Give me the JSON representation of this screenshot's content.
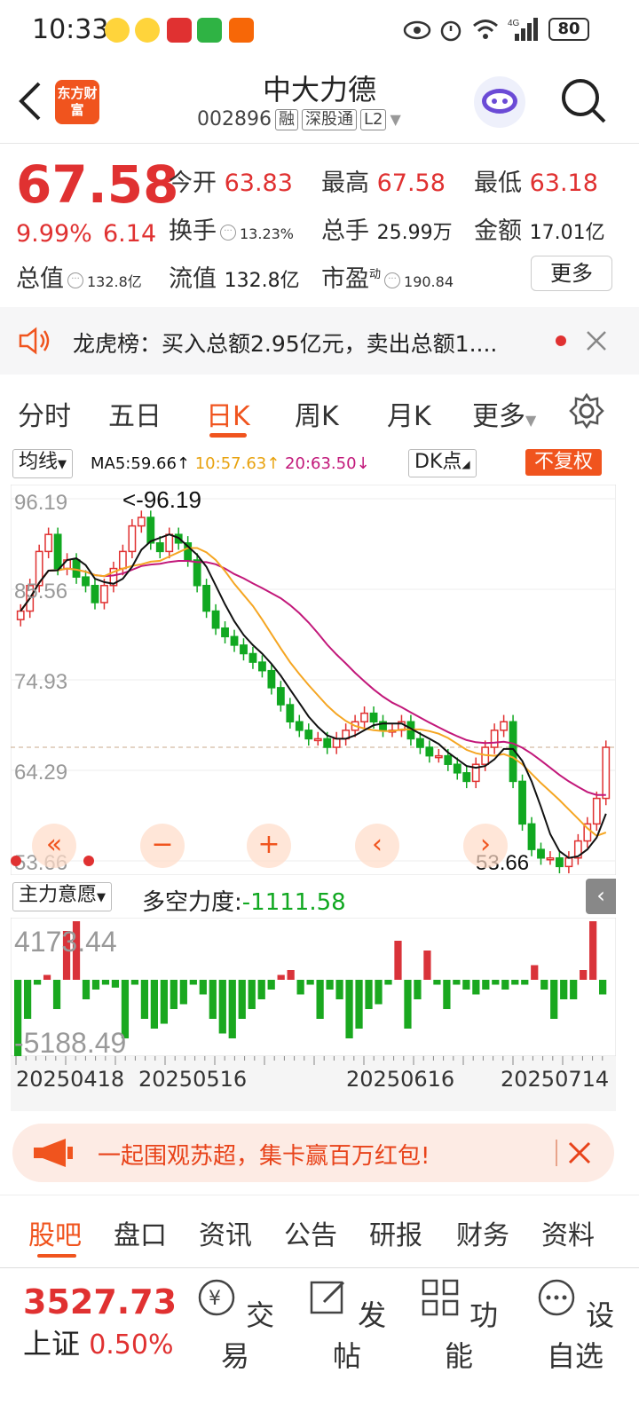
{
  "status": {
    "time": "10:33",
    "battery": "80"
  },
  "header": {
    "logo_text": "东方财富",
    "name": "中大力德",
    "code": "002896",
    "tags": [
      "融",
      "深股通",
      "L2"
    ]
  },
  "quote": {
    "price": "67.58",
    "change_pct": "9.99%",
    "change": "6.14",
    "fields": {
      "open_label": "今开",
      "open": "63.83",
      "high_label": "最高",
      "high": "67.58",
      "low_label": "最低",
      "low": "63.18",
      "turnover_label": "换手",
      "turnover": "13.23%",
      "volume_label": "总手",
      "volume": "25.99万",
      "amount_label": "金额",
      "amount": "17.01亿",
      "mktcap_label": "总值",
      "mktcap": "132.8亿",
      "float_label": "流值",
      "float": "132.8亿",
      "pe_label": "市盈",
      "pe_sup": "动",
      "pe": "190.84"
    },
    "more_label": "更多"
  },
  "notice": {
    "text": "龙虎榜：买入总额2.95亿元，卖出总额1...."
  },
  "tabs": [
    "分时",
    "五日",
    "日K",
    "周K",
    "月K",
    "更多"
  ],
  "active_tab": "日K",
  "chart_toolbar": {
    "ma_select": "均线",
    "ma5": "MA5:59.66↑",
    "ma10": "10:57.63↑",
    "ma20": "20:63.50↓",
    "dk": "DK点",
    "adjust": "不复权"
  },
  "chart_data": [
    {
      "type": "candlestick",
      "y_ticks": [
        "96.19",
        "85.56",
        "74.93",
        "64.29",
        "53.66"
      ],
      "ylim": [
        53.66,
        96.19
      ],
      "annotations": {
        "high": "<-96.19",
        "low": "53.66"
      },
      "ma_series": [
        {
          "name": "MA5",
          "color": "#111111"
        },
        {
          "name": "MA10",
          "color": "#f5a623"
        },
        {
          "name": "MA20",
          "color": "#c2187a"
        }
      ]
    },
    {
      "type": "bar",
      "indicator_select": "主力意愿",
      "indicator_label": "多空力度:",
      "indicator_value": "-1111.58",
      "y_ticks": [
        "4173.44",
        "-5188.49"
      ],
      "x_ticks": [
        "20250418",
        "20250516",
        "20250616",
        "20250714"
      ]
    }
  ],
  "banner": {
    "text": "一起围观苏超，集卡赢百万红包!"
  },
  "bottom_tabs": [
    "股吧",
    "盘口",
    "资讯",
    "公告",
    "研报",
    "财务",
    "资料"
  ],
  "footer": {
    "index_value": "3527.73",
    "index_name": "上证",
    "index_change": "0.50%",
    "buttons": [
      "交易",
      "发帖",
      "功能",
      "设自选"
    ]
  }
}
